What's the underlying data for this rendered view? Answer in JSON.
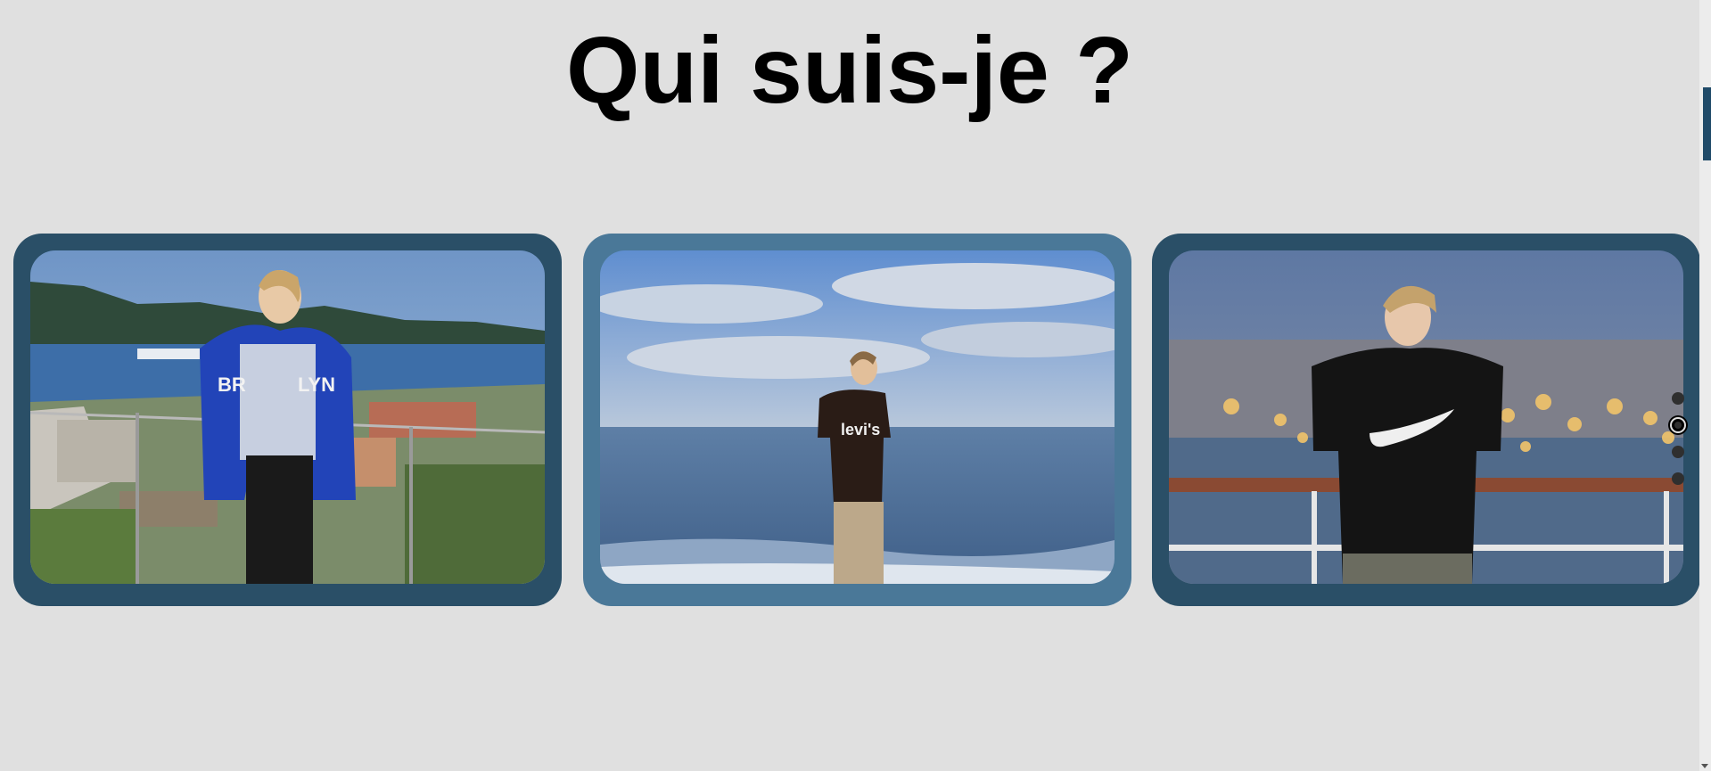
{
  "page": {
    "title": "Qui suis-je ?",
    "background": "#e0e0e0"
  },
  "carousel": {
    "cards": [
      {
        "frame_color": "#2a4f67",
        "photo": "person-harbor-view-photo"
      },
      {
        "frame_color": "#4a7898",
        "photo": "person-seaside-photo"
      },
      {
        "frame_color": "#2a4f67",
        "photo": "person-city-night-photo"
      }
    ],
    "pagination": {
      "count": 4,
      "active_index": 1
    }
  },
  "scrollbar": {
    "thumb_color": "#1f4a68"
  }
}
